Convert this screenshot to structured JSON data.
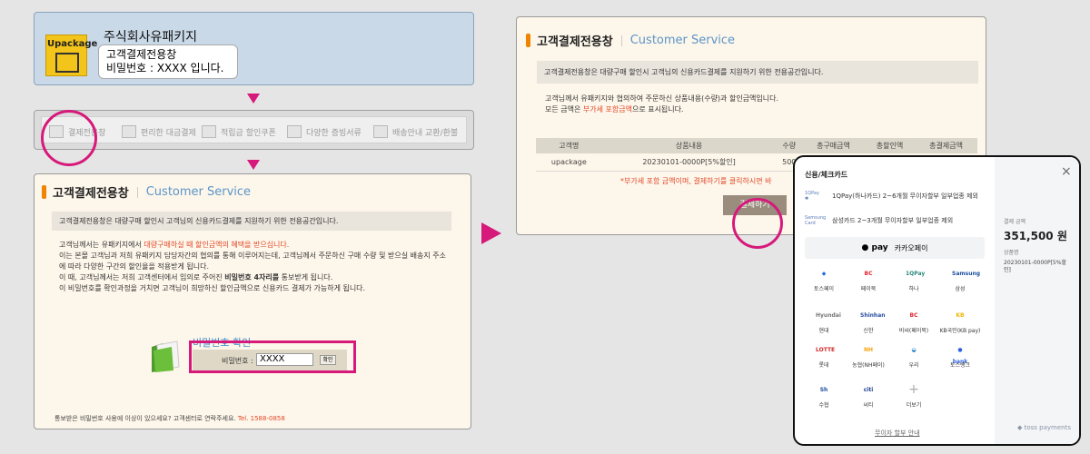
{
  "top_box": {
    "logo_text": "Upackage",
    "company": "주식회사유패키지",
    "bubble_line1": "고객결제전용창",
    "bubble_line2": "비밀번호 : XXXX 입니다."
  },
  "menu": [
    {
      "label": "결제전용창",
      "icon": "card-icon"
    },
    {
      "label": "편리한 대금결제",
      "icon": "payment-icon"
    },
    {
      "label": "적립금 할인쿠폰",
      "icon": "coupon-icon"
    },
    {
      "label": "다양한 증빙서류",
      "icon": "document-icon"
    },
    {
      "label": "배송안내 교환/환불",
      "icon": "delivery-icon"
    }
  ],
  "pw_panel": {
    "title_ko": "고객결제전용창",
    "title_en": "Customer Service",
    "notice": "고객결제전용창은 대량구매 할인시 고객님의 신용카드결제를 지원하기 위한 전용공간입니다.",
    "p1a": "고객님께서는 유패키지에서 ",
    "p1b": "대량구매하실 때 할인금액의 혜택을 받으십니다.",
    "p2": "이는 본몰 고객님과 저희 유패키지 담당자간의 협의를 통해 이루어지는데, 고객님께서 주문하신 구매 수량 및 받으실 배송지 주소",
    "p3": "에 따라 다양한 구간의 할인율을 적용받게 됩니다.",
    "p4a": "이 때, 고객님께서는 저희 고객센터에서 임의로 주어진 ",
    "p4b": "비밀번호 4자리를",
    "p4c": " 통보받게 됩니다.",
    "p5": "이 비밀번호를 확인과정을 거치면 고객님이 희망하신 할인금액으로 신용카드 결제가 가능하게 됩니다.",
    "pw_heading": "비밀번호 확인",
    "pw_label": "비밀번호 :",
    "pw_value": "XXXX",
    "confirm": "확인",
    "contact": "통보받은 비밀번호 사용에 이상이 있으세요? 고객센터로 연락주세요.",
    "tel": "Tel. 1588-0858"
  },
  "cs_panel": {
    "title_ko": "고객결제전용창",
    "title_en": "Customer Service",
    "notice": "고객결제전용창은 대량구매 할인시 고객님의 신용카드결제를 지원하기 위한 전용공간입니다.",
    "p1": "고객님께서 유패키지와 협의하여 주문하신 상품내용(수량)과 할인금액입니다.",
    "p2a": "모든 금액은 ",
    "p2b": "부가세 포함금액",
    "p2c": "으로 표시됩니다.",
    "headers": [
      "고객명",
      "상품내용",
      "수량",
      "총구매금액",
      "총할인액",
      "총결제금액"
    ],
    "row": [
      "upackage",
      "20230101-0000P[5%할인]",
      "500",
      "",
      "",
      ""
    ],
    "footnote": "*부가세 포함 금액이며, 결제하기를 클릭하시면 바",
    "pay_button": "결제하기"
  },
  "modal": {
    "title": "신용/체크카드",
    "close": "×",
    "promo1_logo": "1QPay ✱",
    "promo1": "1QPay(하나카드) 2~6개월 무이자할부 일부업종 제외",
    "promo2_logo": "Samsung Card",
    "promo2": "삼성카드 2~3개월 무이자할부 일부업종 제외",
    "kakao_logo": "● pay",
    "kakao_label": "카카오페이",
    "banks": [
      {
        "label": "토스페이",
        "logo": "◆",
        "color": "#2a6fd8"
      },
      {
        "label": "페이북",
        "logo": "BC",
        "color": "#e0242e"
      },
      {
        "label": "하나",
        "logo": "1QPay",
        "color": "#2a8a7c"
      },
      {
        "label": "삼성",
        "logo": "Samsung",
        "color": "#1d4fa0"
      },
      {
        "label": "현대",
        "logo": "Hyundai",
        "color": "#777"
      },
      {
        "label": "신한",
        "logo": "Shinhan",
        "color": "#2a4fa0"
      },
      {
        "label": "비씨(페이북)",
        "logo": "BC",
        "color": "#e0242e"
      },
      {
        "label": "KB국민(KB pay)",
        "logo": "KB",
        "color": "#f2b705"
      },
      {
        "label": "롯데",
        "logo": "LOTTE",
        "color": "#d12a2a"
      },
      {
        "label": "농협(NH페이)",
        "logo": "NH",
        "color": "#f5a40c"
      },
      {
        "label": "우리",
        "logo": "◒",
        "color": "#1f7fc8"
      },
      {
        "label": "토스뱅크",
        "logo": "● bank",
        "color": "#3063e0"
      },
      {
        "label": "수협",
        "logo": "Sh",
        "color": "#1d4fa0"
      },
      {
        "label": "씨티",
        "logo": "citi",
        "color": "#1b3f8f"
      },
      {
        "label": "더보기",
        "logo": "+",
        "color": "#aaa"
      }
    ],
    "amount_label": "결제 금액",
    "amount": "351,500 원",
    "product_label": "상품명",
    "product_line1": "20230101-0000P[5%할",
    "product_line2": "인]",
    "inquiry": "무이자 할부 안내",
    "toss": "◆ toss payments"
  },
  "colors": {
    "accent": "#d6197a",
    "orange": "#f08300",
    "blue_title": "#5b95c8"
  }
}
